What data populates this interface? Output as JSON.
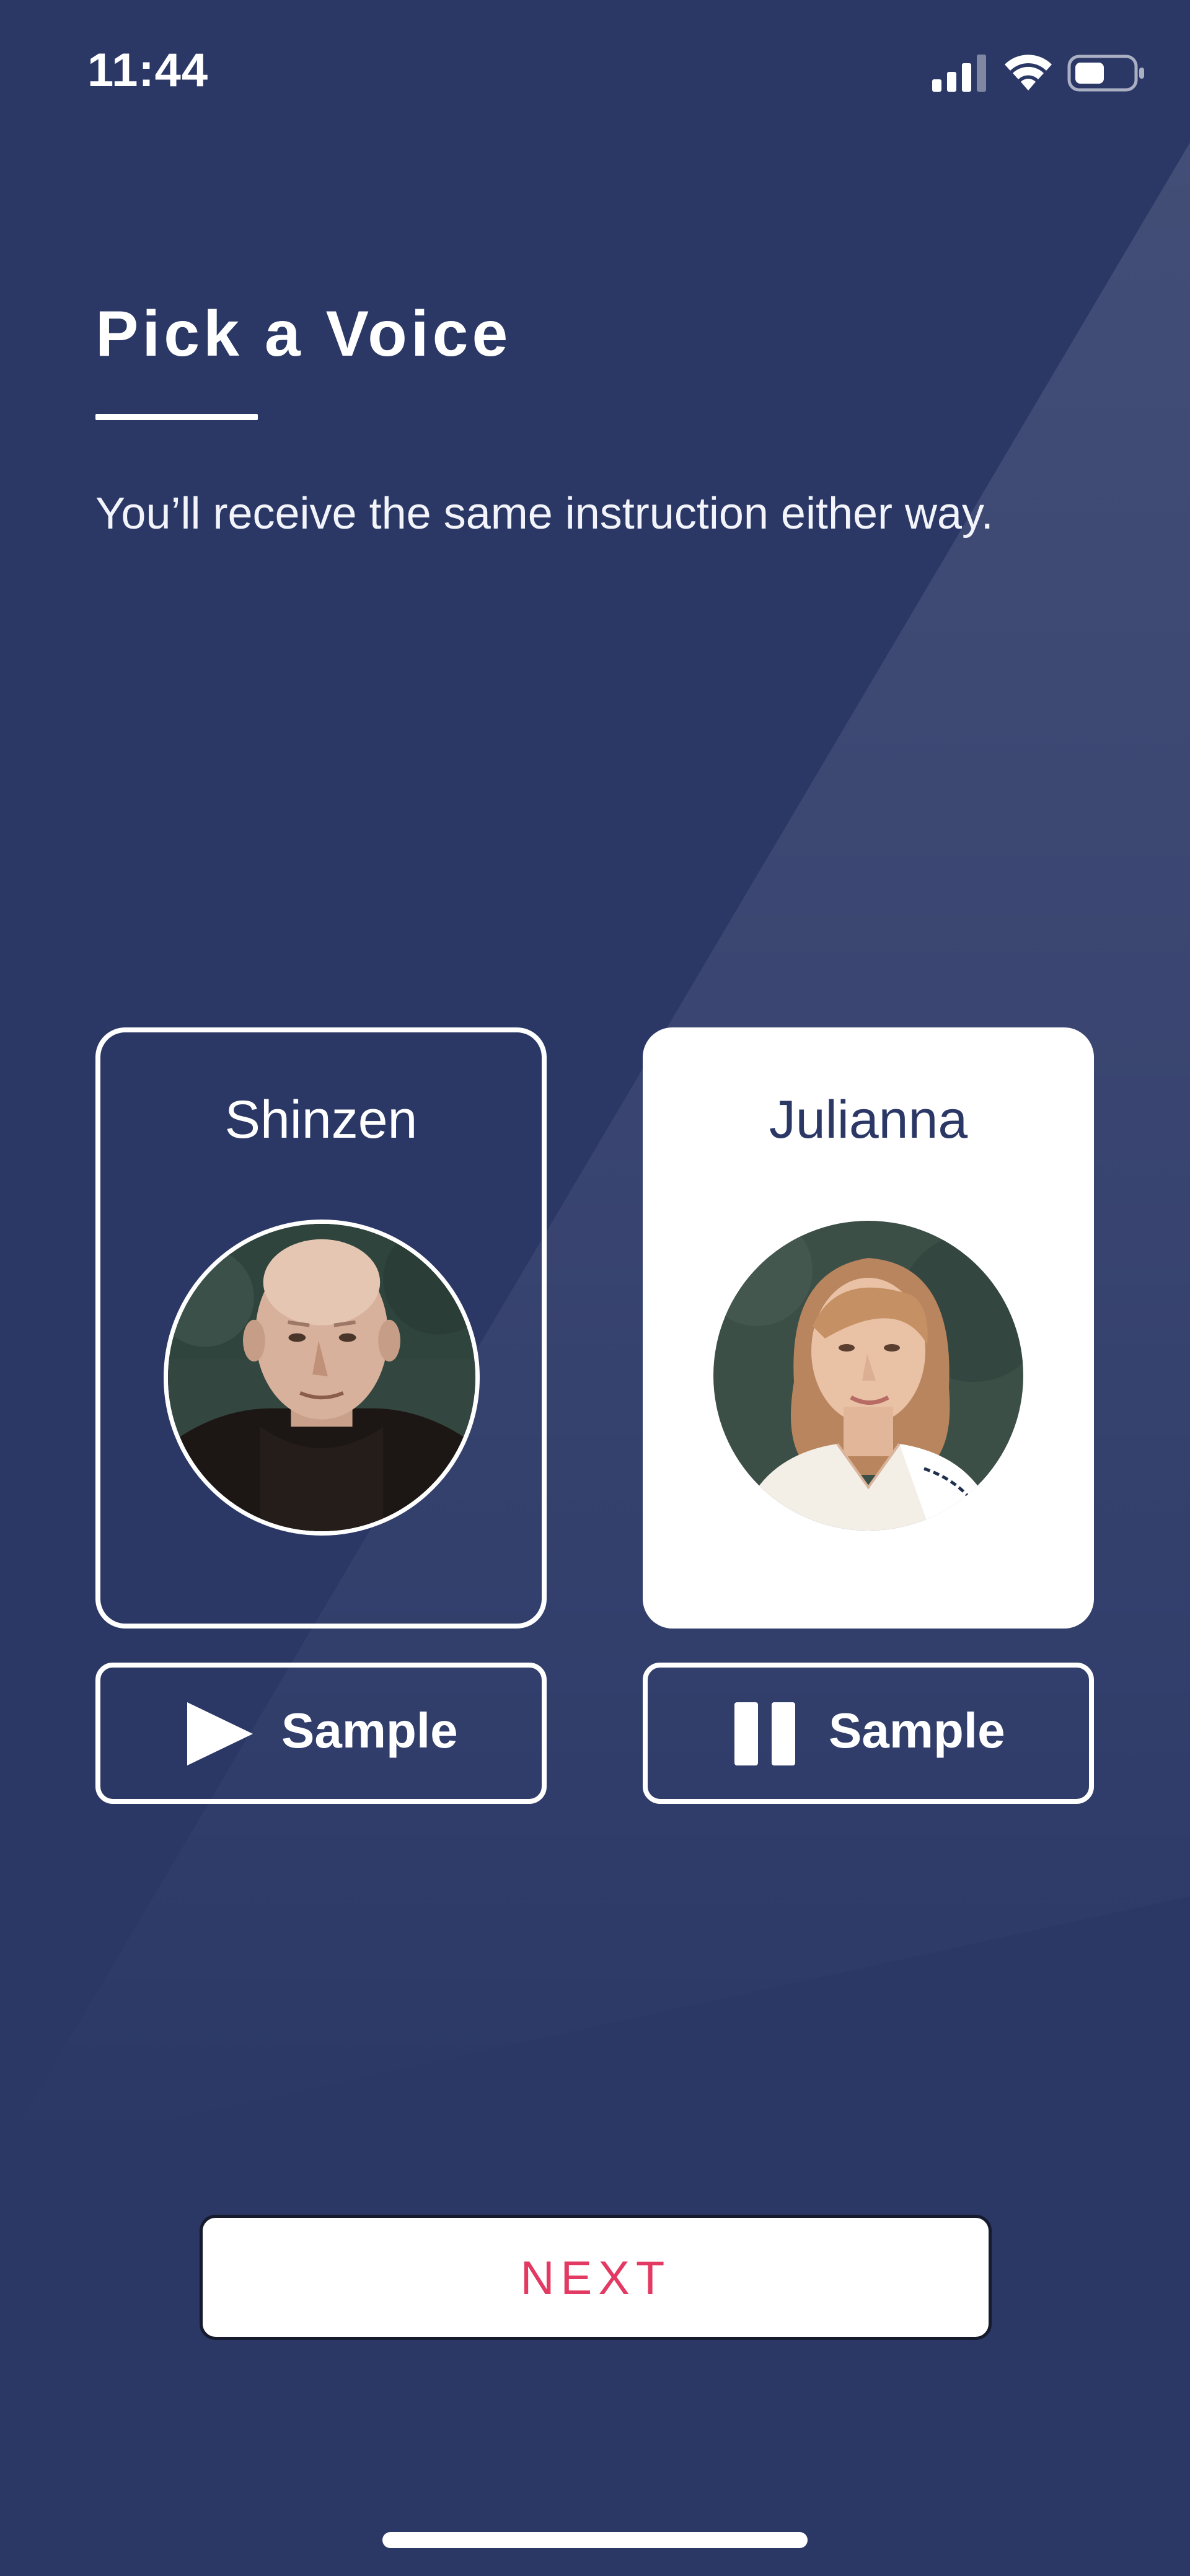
{
  "status_bar": {
    "time": "11:44",
    "icons": [
      "cellular-signal-icon",
      "wifi-icon",
      "battery-icon"
    ]
  },
  "header": {
    "title": "Pick a Voice",
    "subtitle": "You’ll receive the same instruction either way."
  },
  "voices": [
    {
      "name": "Shinzen",
      "selected": false,
      "sample_label": "Sample",
      "sample_icon": "play-icon"
    },
    {
      "name": "Julianna",
      "selected": true,
      "sample_label": "Sample",
      "sample_icon": "pause-icon"
    }
  ],
  "footer": {
    "next_label": "NEXT"
  },
  "colors": {
    "background": "#2b3866",
    "card_selected": "#ffffff",
    "accent": "#e23a62",
    "text_dark": "#2b3866"
  }
}
